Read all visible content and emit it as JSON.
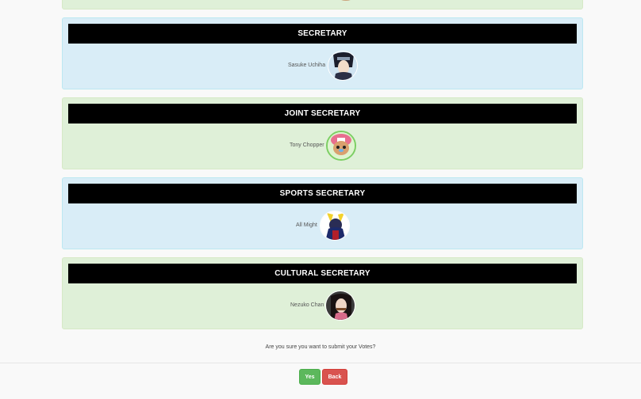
{
  "colors": {
    "green_panel": "#dff0d8",
    "blue_panel": "#d9edf7",
    "header_bar": "#000000",
    "yes_button": "#5cb85c",
    "back_button": "#d9534f"
  },
  "positions": [
    {
      "title": "SECRETARY",
      "candidate": "Sasuke Uchiha",
      "avatar_icon": "sasuke-avatar"
    },
    {
      "title": "JOINT SECRETARY",
      "candidate": "Tony Chopper",
      "avatar_icon": "chopper-avatar"
    },
    {
      "title": "SPORTS SECRETARY",
      "candidate": "All Might",
      "avatar_icon": "all-might-avatar"
    },
    {
      "title": "CULTURAL SECRETARY",
      "candidate": "Nezuko Chan",
      "avatar_icon": "nezuko-avatar"
    }
  ],
  "confirm": {
    "question": "Are you sure you want to submit your Votes?",
    "yes_label": "Yes",
    "back_label": "Back"
  }
}
